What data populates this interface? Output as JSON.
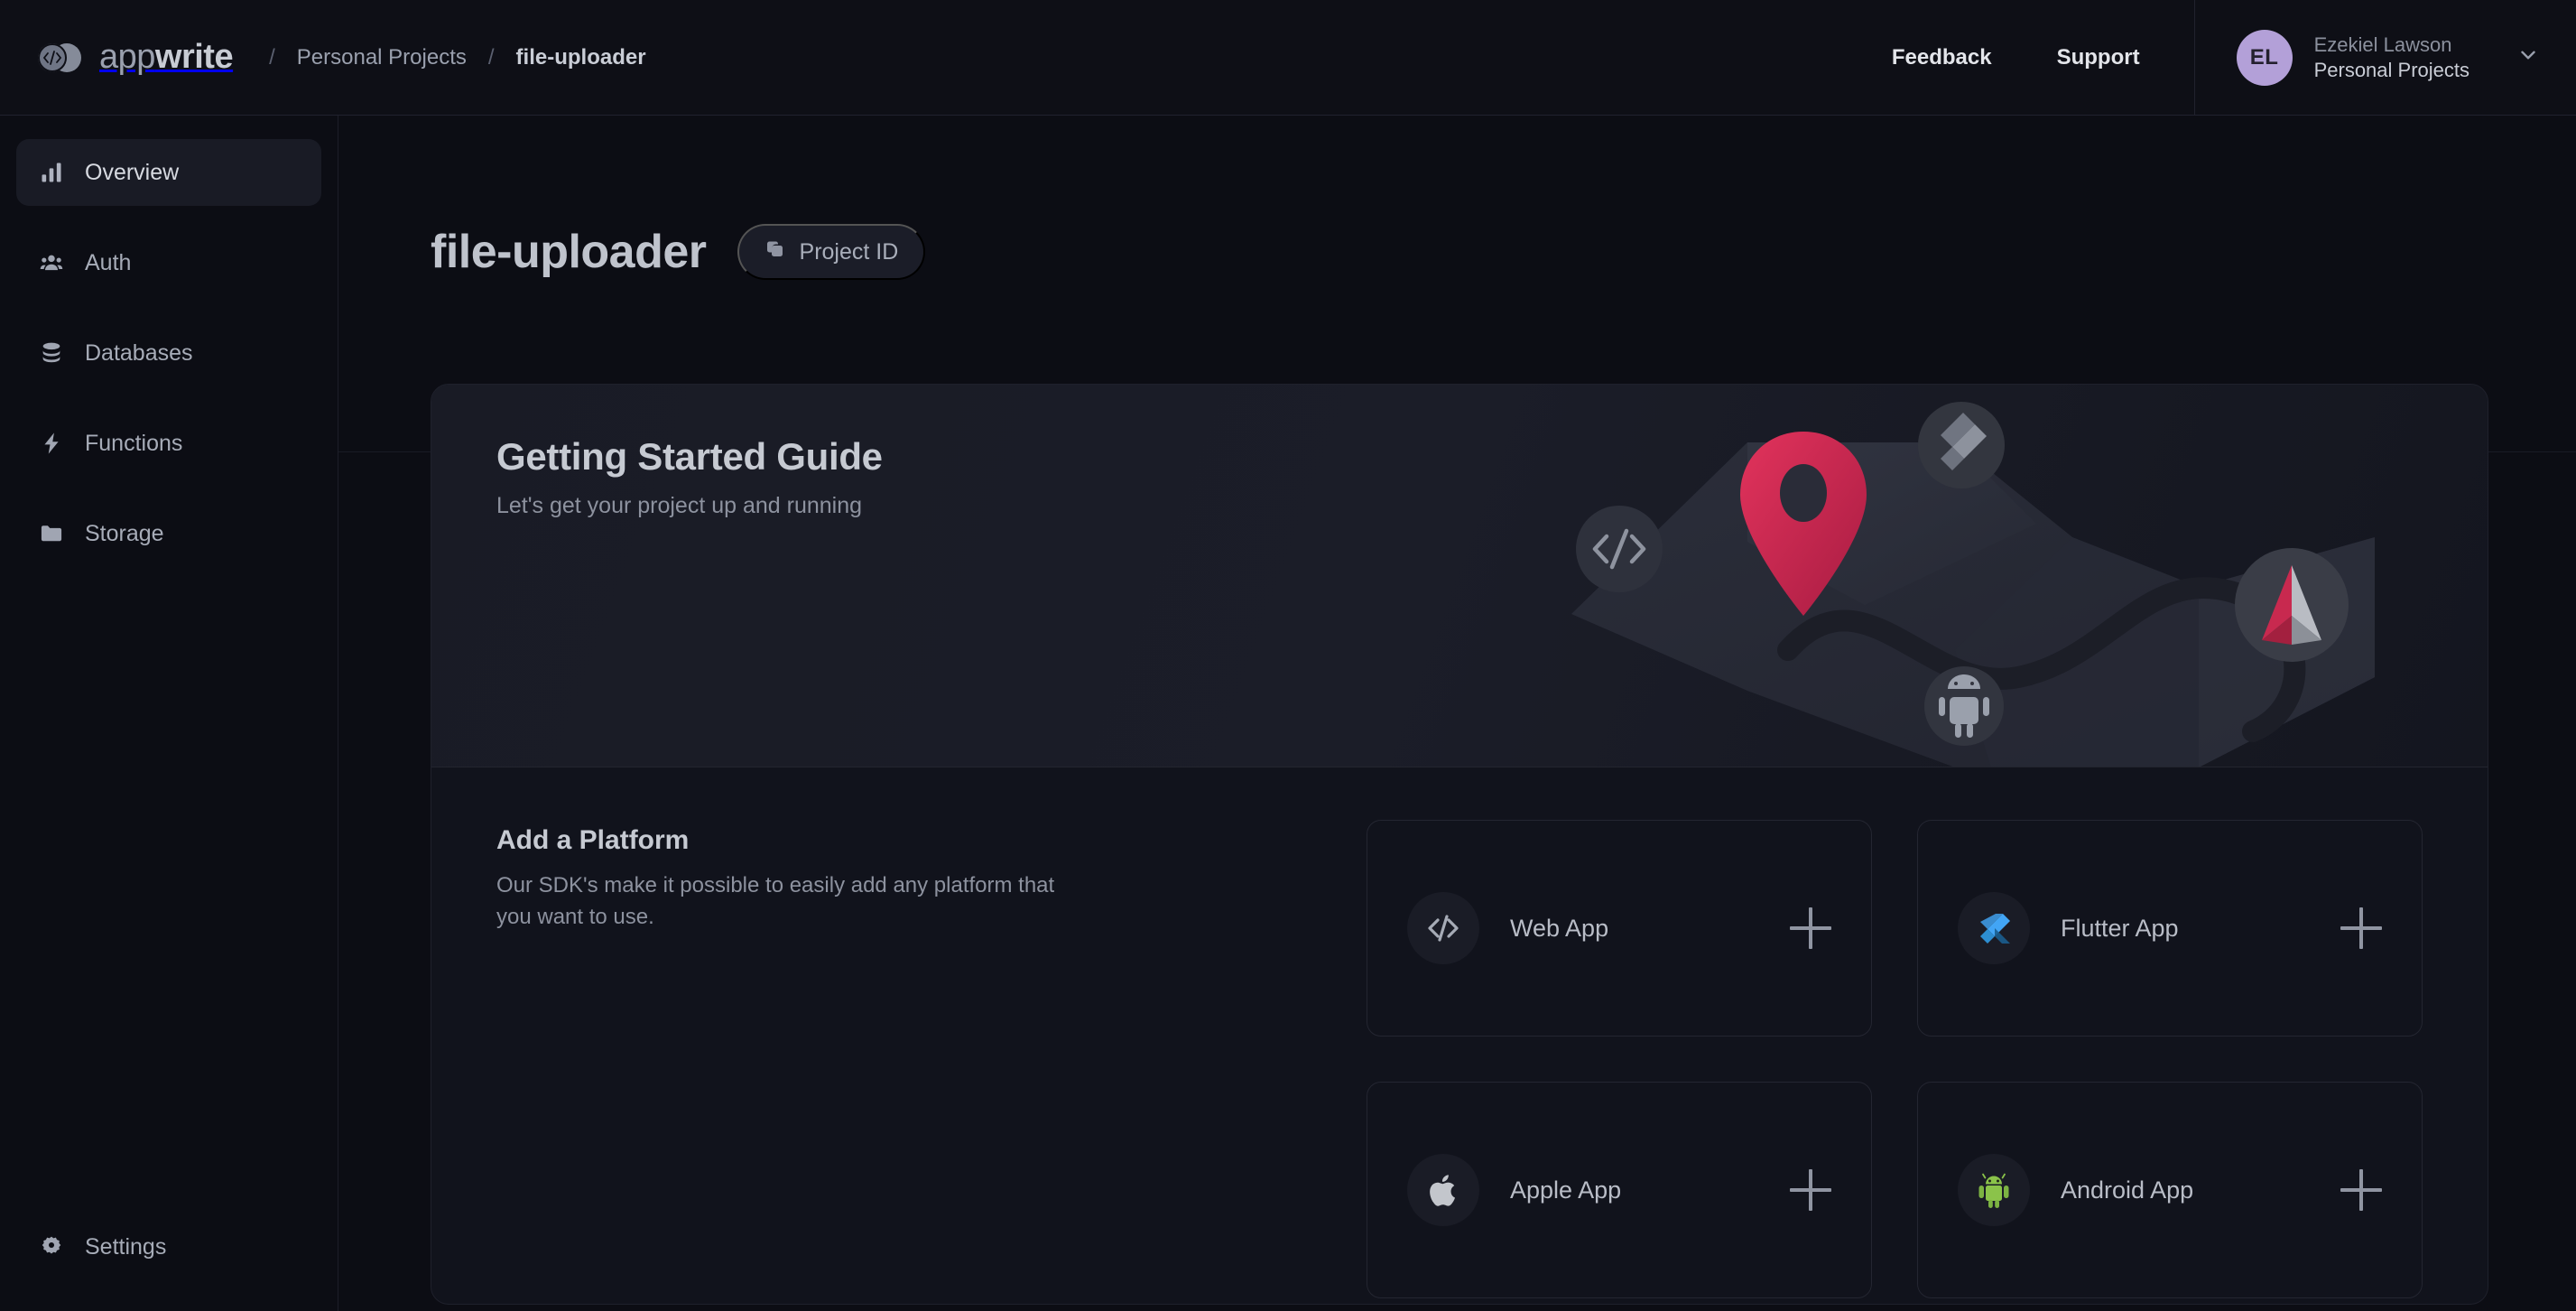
{
  "header": {
    "brand": {
      "name_light": "app",
      "name_bold": "write"
    },
    "breadcrumb": {
      "sep": "/",
      "org": "Personal Projects",
      "project": "file-uploader"
    },
    "links": [
      {
        "label": "Feedback",
        "name": "feedback-link"
      },
      {
        "label": "Support",
        "name": "support-link"
      }
    ],
    "user": {
      "initials": "EL",
      "name": "Ezekiel Lawson",
      "org": "Personal Projects"
    }
  },
  "sidebar": {
    "items": [
      {
        "label": "Overview",
        "icon": "bar-chart-icon",
        "active": true
      },
      {
        "label": "Auth",
        "icon": "users-icon",
        "active": false
      },
      {
        "label": "Databases",
        "icon": "database-icon",
        "active": false
      },
      {
        "label": "Functions",
        "icon": "lightning-icon",
        "active": false
      },
      {
        "label": "Storage",
        "icon": "folder-icon",
        "active": false
      }
    ],
    "bottom": {
      "label": "Settings",
      "icon": "gear-icon"
    }
  },
  "main": {
    "page_title": "file-uploader",
    "project_id_button": {
      "label": "Project ID",
      "icon": "copy-icon"
    },
    "hero": {
      "title": "Getting Started Guide",
      "subtitle": "Let's get your project up and running",
      "illustration": "map-illustration"
    },
    "platforms": {
      "title": "Add a Platform",
      "description": "Our SDK's make it possible to easily add any platform that you want to use.",
      "cards": [
        {
          "label": "Web App",
          "icon": "code-icon",
          "action": "+"
        },
        {
          "label": "Flutter App",
          "icon": "flutter-icon",
          "action": "+"
        },
        {
          "label": "Apple App",
          "icon": "apple-icon",
          "action": "+"
        },
        {
          "label": "Android App",
          "icon": "android-icon",
          "action": "+"
        }
      ]
    }
  },
  "colors": {
    "page_bg": "#0c0d14",
    "card_bg": "#11131c",
    "accent_pin": "#c8days",
    "accent_pink": "#cf2a52",
    "avatar": "#b3a0d8",
    "flutter_blue": "#42a5f5",
    "android_green": "#7fbd42",
    "apple_gray": "#c3c6cc"
  }
}
